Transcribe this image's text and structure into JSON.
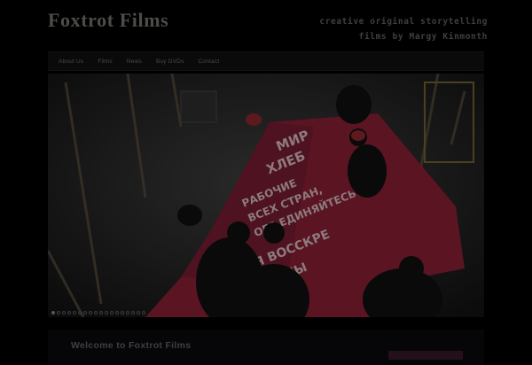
{
  "site": {
    "title": "Foxtrot Films",
    "tagline_line1": "creative original storytelling",
    "tagline_line2": "films by Margy Kinmonth"
  },
  "nav": {
    "items": [
      {
        "label": "About Us"
      },
      {
        "label": "Films"
      },
      {
        "label": "News"
      },
      {
        "label": "Buy DVDs"
      },
      {
        "label": "Contact"
      }
    ]
  },
  "slider": {
    "banner_lines": [
      "МИР",
      "ХЛЕБ",
      "РАБОЧИЕ",
      "ВСЕХ СТРАН,",
      "ОБЪЕДИНЯЙТЕСЬ!",
      "ПЛАМЯ ВОССКРЕ",
      "ВОЙНЫ"
    ],
    "dot_count": 18,
    "active_dot": 1
  },
  "welcome": {
    "title": "Welcome to Foxtrot Films"
  },
  "colors": {
    "background": "#000000",
    "banner_red": "#5a1422",
    "text_dim": "#4c4c48"
  }
}
